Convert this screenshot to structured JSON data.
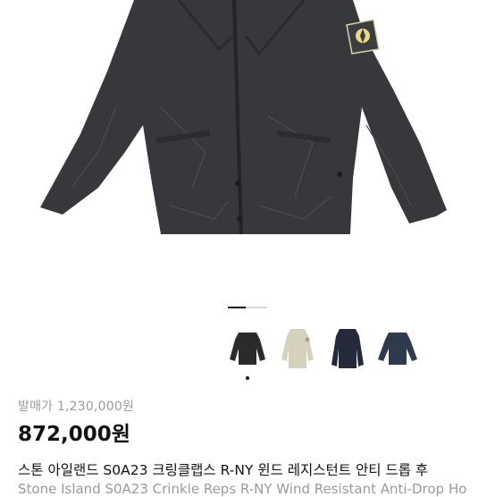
{
  "product": {
    "image_icon": "jacket-image",
    "original_price": "발매가 1,230,000원",
    "sale_price": "872,000원",
    "title_ko": "스톤 아일랜드 S0A23 크링클랩스 R-NY 윈드 레지스턴트 안티 드롭 후",
    "title_en": "Stone Island S0A23 Crinkle Reps R-NY Wind Resistant Anti-Drop Ho"
  },
  "gallery": {
    "thumbnails": [
      {
        "name": "thumb-black",
        "color": "#2b2b2c"
      },
      {
        "name": "thumb-beige",
        "color": "#d4d2bd"
      },
      {
        "name": "thumb-navy",
        "color": "#26293a"
      },
      {
        "name": "thumb-navy-blue",
        "color": "#2f3a4d"
      }
    ],
    "selected_index": 0
  },
  "colors": {
    "jacket_main": "#36383b",
    "jacket_shadow": "#25272a",
    "price_text": "#111111",
    "muted_text": "#9a9a9a"
  }
}
